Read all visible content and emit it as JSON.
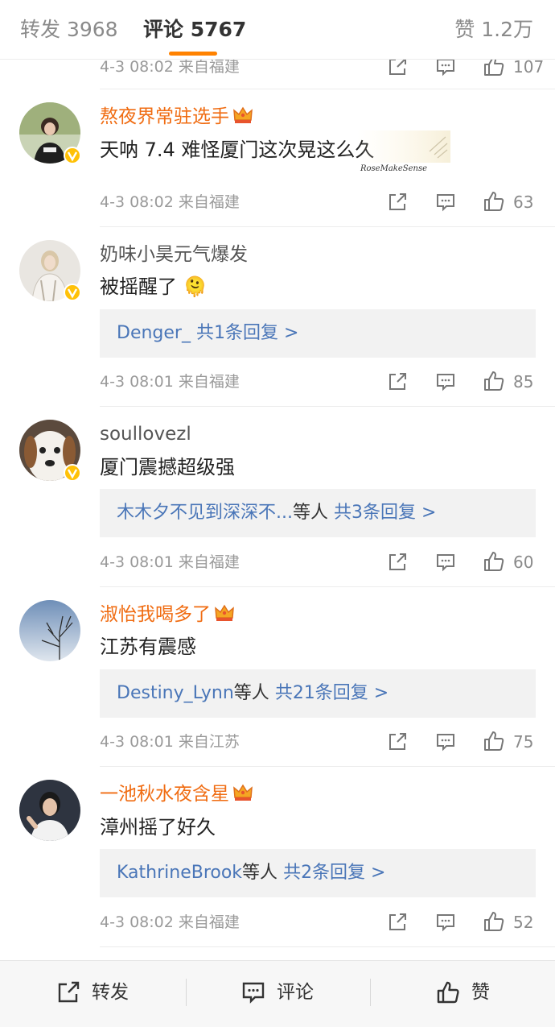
{
  "tabs": {
    "repost": "转发 3968",
    "comment": "评论 5767",
    "likes": "赞 1.2万"
  },
  "partial_row": {
    "time": "4-3 08:02",
    "source": "来自福建",
    "like_count": "107"
  },
  "comments": [
    {
      "username": "熬夜界常驻选手",
      "vip": true,
      "text": "天呐 7.4 难怪厦门这次晃这么久",
      "sticker_text": "RoseMakeSense",
      "time": "4-3 08:02",
      "source": "来自福建",
      "like_count": "63"
    },
    {
      "username": "奶味小昊元气爆发",
      "vip": false,
      "text": "被摇醒了",
      "emoji": "🫠",
      "reply_user": "Denger_",
      "reply_others": "",
      "reply_count": "共1条回复 >",
      "time": "4-3 08:01",
      "source": "来自福建",
      "like_count": "85"
    },
    {
      "username": "soullovezl",
      "vip": false,
      "text": "厦门震撼超级强",
      "reply_user": "木木夕不见到深深不...",
      "reply_others": "等人",
      "reply_count": "共3条回复 >",
      "time": "4-3 08:01",
      "source": "来自福建",
      "like_count": "60"
    },
    {
      "username": "淑怡我喝多了",
      "vip": true,
      "text": "江苏有震感",
      "reply_user": "Destiny_Lynn",
      "reply_others": "等人",
      "reply_count": "共21条回复 >",
      "time": "4-3 08:01",
      "source": "来自江苏",
      "like_count": "75"
    },
    {
      "username": "一池秋水夜含星",
      "vip": true,
      "text": "漳州摇了好久",
      "reply_user": "KathrineBrook",
      "reply_others": "等人",
      "reply_count": "共2条回复 >",
      "time": "4-3 08:02",
      "source": "来自福建",
      "like_count": "52"
    }
  ],
  "bottom_bar": {
    "repost": "转发",
    "comment": "评论",
    "like": "赞"
  },
  "colors": {
    "accent": "#ff8200",
    "vip_name": "#f06c12",
    "reply_link": "#4a76b8",
    "verified_badge": "#ffc107"
  },
  "icons": [
    "share-icon",
    "comment-icon",
    "thumbs-up-icon",
    "crown-icon",
    "verified-badge-icon"
  ]
}
